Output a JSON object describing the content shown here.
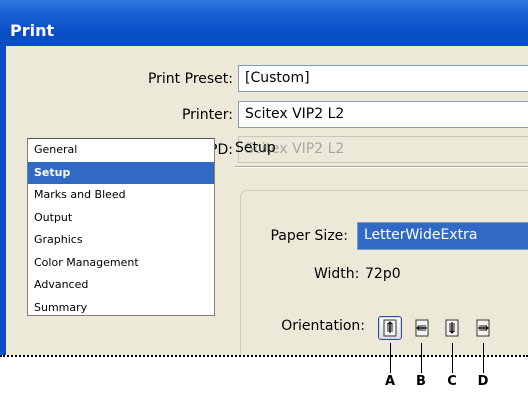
{
  "window": {
    "title": "Print"
  },
  "form": {
    "preset_label": "Print Preset:",
    "preset_value": "[Custom]",
    "printer_label": "Printer:",
    "printer_value": "Scitex VIP2 L2",
    "ppd_label": "PPD:",
    "ppd_value": "Scitex VIP2 L2"
  },
  "categories": [
    {
      "label": "General",
      "selected": false
    },
    {
      "label": "Setup",
      "selected": true
    },
    {
      "label": "Marks and Bleed",
      "selected": false
    },
    {
      "label": "Output",
      "selected": false
    },
    {
      "label": "Graphics",
      "selected": false
    },
    {
      "label": "Color Management",
      "selected": false
    },
    {
      "label": "Advanced",
      "selected": false
    },
    {
      "label": "Summary",
      "selected": false
    }
  ],
  "setup": {
    "heading": "Setup",
    "paper_size_label": "Paper Size:",
    "paper_size_value": "LetterWideExtra",
    "width_label": "Width:",
    "width_value": "72p0",
    "orientation_label": "Orientation:",
    "orientation_buttons": [
      {
        "icon": "portrait-orientation-icon",
        "active": true
      },
      {
        "icon": "landscape-orientation-icon",
        "active": false
      },
      {
        "icon": "reverse-portrait-orientation-icon",
        "active": false
      },
      {
        "icon": "reverse-landscape-orientation-icon",
        "active": false
      }
    ]
  },
  "callouts": [
    "A",
    "B",
    "C",
    "D"
  ],
  "colors": {
    "titlebar": "#0a4ec7",
    "selection": "#316ac5",
    "dialog_bg": "#ece9d8"
  }
}
